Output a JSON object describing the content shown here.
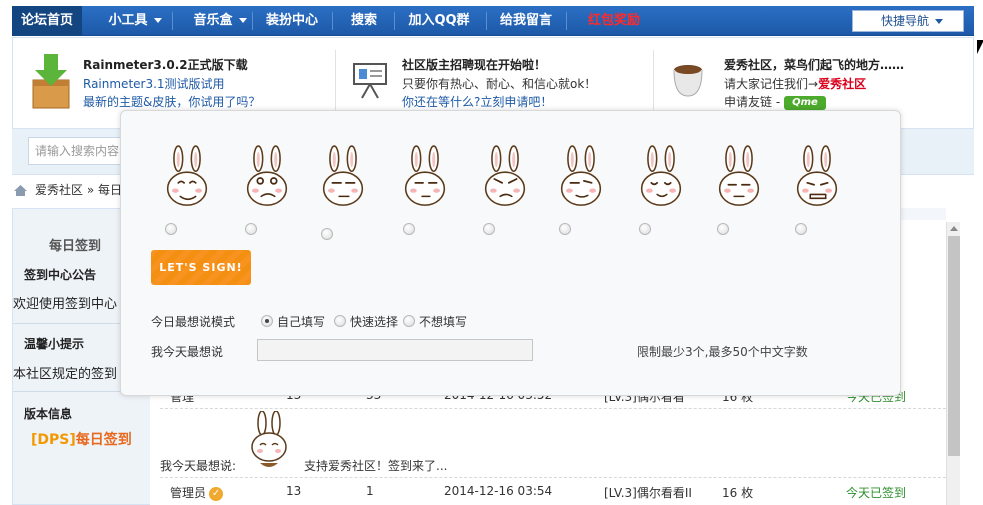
{
  "nav": {
    "items": [
      {
        "label": "论坛首页"
      },
      {
        "label": "小工具"
      },
      {
        "label": "音乐盒"
      },
      {
        "label": "装扮中心"
      },
      {
        "label": "搜索"
      },
      {
        "label": "加入QQ群"
      },
      {
        "label": "给我留言"
      },
      {
        "label": "红包奖励"
      }
    ],
    "quick_nav": "快捷导航"
  },
  "banner": {
    "col1": {
      "title": "Rainmeter3.0.2正式版下载",
      "line2": "Rainmeter3.1测试版试用",
      "line3": "最新的主题&皮肤，你试用了吗？"
    },
    "col2": {
      "title": "社区版主招聘现在开始啦！",
      "line2": "只要你有热心、耐心、和信心就ok！",
      "line3": "你还在等什么?立刻申请吧！"
    },
    "col3": {
      "title": "爱秀社区，菜鸟们起飞的地方……",
      "line2_pre": "请大家记住我们→",
      "line2_hl": "爱秀社区",
      "line3": "申请友链 -",
      "qme": "Qme"
    }
  },
  "search": {
    "placeholder": "请输入搜索内容"
  },
  "breadcrumb": {
    "site": "爱秀社区",
    "sep": "»",
    "current": "每日"
  },
  "left_panel": {
    "title": "每日签到",
    "notice_heading": "签到中心公告",
    "notice_text": "欢迎使用签到中心",
    "tips_heading": "温馨小提示",
    "tips_text": "本社区规定的签到",
    "version_heading": "版本信息",
    "version_tag": "[DPS]",
    "version_name": "每日签到"
  },
  "list": {
    "partial_row": {
      "user": "管理",
      "count": "13",
      "days": "33",
      "time": "2014-12-16 03:52",
      "level": "[LV.3]偶尔看看",
      "reward": "16 枚",
      "status": "今天已签到"
    },
    "mood_label": "我今天最想说:",
    "mood_text": "支持爱秀社区！签到来了...",
    "row": {
      "user": "管理员",
      "count": "13",
      "days": "1",
      "time": "2014-12-16 03:54",
      "level": "[LV.3]偶尔看看II",
      "reward": "16 枚",
      "status": "今天已签到"
    }
  },
  "modal": {
    "emojis": [
      {
        "icon": "happy-rabbit-icon",
        "selected": false
      },
      {
        "icon": "crying-rabbit-icon",
        "selected": false
      },
      {
        "icon": "smoking-rabbit-icon",
        "selected": false
      },
      {
        "icon": "bored-rabbit-icon",
        "selected": false
      },
      {
        "icon": "angry-rabbit-icon",
        "selected": false
      },
      {
        "icon": "sweating-rabbit-icon",
        "selected": false
      },
      {
        "icon": "eating-rabbit-icon",
        "selected": false
      },
      {
        "icon": "lying-rabbit-icon",
        "selected": false
      },
      {
        "icon": "grinning-rabbit-icon",
        "selected": false
      }
    ],
    "sign_button": "LET'S SIGN!",
    "mode_label": "今日最想说模式",
    "mode_options": [
      {
        "label": "自己填写",
        "selected": true
      },
      {
        "label": "快速选择",
        "selected": false
      },
      {
        "label": "不想填写",
        "selected": false
      }
    ],
    "input_label": "我今天最想说",
    "input_value": "",
    "limit_text": "限制最少3个,最多50个中文字数"
  },
  "colors": {
    "nav_bg": "#1d59a8",
    "nav_home_bg": "#134580",
    "accent_orange": "#f7931e",
    "status_green": "#2c8f2c",
    "highlight_red": "#d9001b"
  }
}
